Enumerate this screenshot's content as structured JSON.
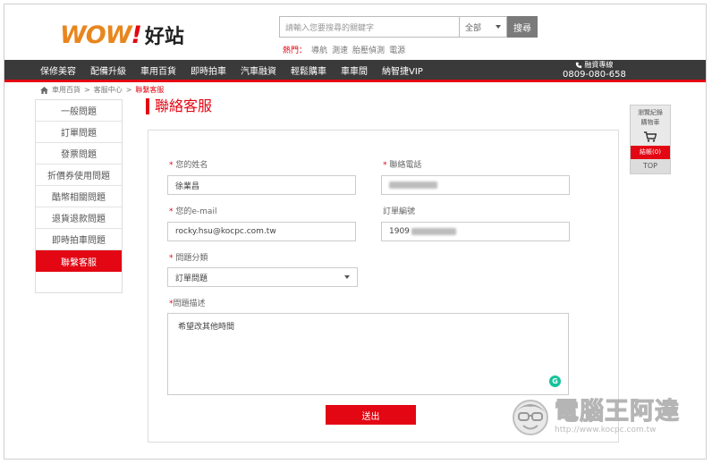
{
  "header": {
    "logo_wow": "WOW",
    "logo_exclaim": "!",
    "logo_site": "好站",
    "search_placeholder": "請輸入您要搜尋的關鍵字",
    "search_scope": "全部",
    "search_button": "搜尋",
    "hot_label": "熱門：",
    "hot_tags": [
      "導航",
      "測速",
      "胎壓偵測",
      "電源"
    ]
  },
  "nav": {
    "items": [
      "保修美容",
      "配備升級",
      "車用百貨",
      "即時拍車",
      "汽車融資",
      "輕鬆購車",
      "車車間",
      "納智捷VIP"
    ],
    "hotline_label": "融資專線",
    "hotline_number": "0809-080-658"
  },
  "breadcrumb": [
    "車用百貨",
    "客服中心",
    "聯繫客服"
  ],
  "sidebar": {
    "items": [
      "一般問題",
      "訂單問題",
      "發票問題",
      "折價券使用問題",
      "酷幣相關問題",
      "退貨退款問題",
      "即時拍車問題",
      "聯繫客服"
    ],
    "active_index": 7
  },
  "page_title": "聯絡客服",
  "form": {
    "name_label": "您的姓名",
    "name_value": "徐業昌",
    "phone_label": "聯絡電話",
    "email_label": "您的e-mail",
    "email_value": "rocky.hsu@kocpc.com.tw",
    "order_label": "訂單編號",
    "order_value_prefix": "1909",
    "category_label": "問題分類",
    "category_value": "訂單問題",
    "desc_label": "問題描述",
    "desc_value": "希望改其他時間",
    "submit_label": "送出",
    "required_mark": "*"
  },
  "float_widget": {
    "viewed": "瀏覽紀錄",
    "cart": "購物車",
    "checkout": "結帳(0)",
    "top": "TOP"
  },
  "watermark": {
    "title": "電腦王阿達",
    "url": "http://www.kocpc.com.tw"
  },
  "colors": {
    "brand_red": "#e30613",
    "logo_orange": "#e8861e",
    "nav_dark": "#3a3a3a"
  }
}
